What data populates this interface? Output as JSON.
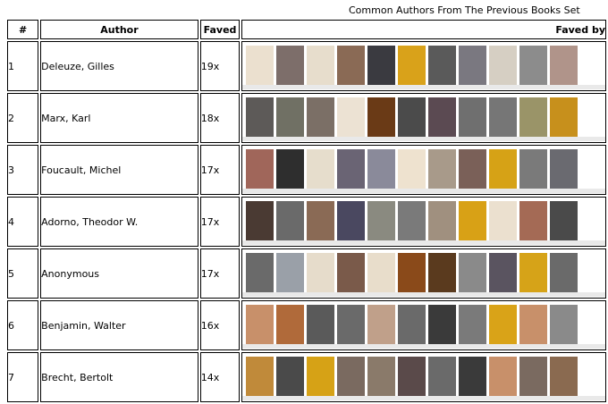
{
  "caption": "Common Authors From The Previous Books Set",
  "headers": {
    "num": "#",
    "author": "Author",
    "faved": "Faved",
    "favedby": "Faved by"
  },
  "rows": [
    {
      "num": "1",
      "author": "Deleuze, Gilles",
      "faved": "19x",
      "thumbs": [
        "#ebe0cf",
        "#7d6e6a",
        "#e7ddcc",
        "#8a6a55",
        "#3a3a40",
        "#d9a21a",
        "#5a5a5a",
        "#7a7880",
        "#d6cfc3",
        "#8c8c8c",
        "#b0948a"
      ]
    },
    {
      "num": "2",
      "author": "Marx, Karl",
      "faved": "18x",
      "thumbs": [
        "#5d5a58",
        "#707064",
        "#7b6f66",
        "#ece2d3",
        "#6a3a16",
        "#4b4b4b",
        "#5b4a52",
        "#6f6f6f",
        "#767676",
        "#9a9468",
        "#c7901c"
      ]
    },
    {
      "num": "3",
      "author": "Foucault, Michel",
      "faved": "17x",
      "thumbs": [
        "#a0665a",
        "#2e2e2e",
        "#e6ddcc",
        "#6a6474",
        "#8a8a9a",
        "#eee2cf",
        "#a89a8a",
        "#7a6058",
        "#d6a216",
        "#7a7a7a",
        "#6a6a70"
      ]
    },
    {
      "num": "4",
      "author": "Adorno, Theodor W.",
      "faved": "17x",
      "thumbs": [
        "#4a3a33",
        "#6a6a6a",
        "#8a6a55",
        "#4a4860",
        "#8a8a80",
        "#7a7a7a",
        "#a0907f",
        "#d8a116",
        "#ebe0cf",
        "#a46a55",
        "#4a4a4a"
      ]
    },
    {
      "num": "5",
      "author": "Anonymous",
      "faved": "17x",
      "thumbs": [
        "#6a6a6a",
        "#9aa0a8",
        "#e6dccb",
        "#7a5a4a",
        "#e8ddcb",
        "#8a4a1a",
        "#5a3a1e",
        "#8a8a8a",
        "#5a5460",
        "#d6a318",
        "#6a6a6a"
      ]
    },
    {
      "num": "6",
      "author": "Benjamin, Walter",
      "faved": "16x",
      "thumbs": [
        "#c8906a",
        "#b06a3a",
        "#5a5a5a",
        "#6a6a6a",
        "#c0a08a",
        "#6a6a6a",
        "#3a3a3a",
        "#7a7a7a",
        "#d9a318",
        "#c8906a",
        "#8a8a8a"
      ]
    },
    {
      "num": "7",
      "author": "Brecht, Bertolt",
      "faved": "14x",
      "thumbs": [
        "#c08a3a",
        "#4a4a4a",
        "#d6a216",
        "#7a6a60",
        "#8a7a6a",
        "#5a4a4a",
        "#6a6a6a",
        "#3a3a3a",
        "#c8906a",
        "#7a6a60",
        "#8a6a50"
      ]
    }
  ]
}
